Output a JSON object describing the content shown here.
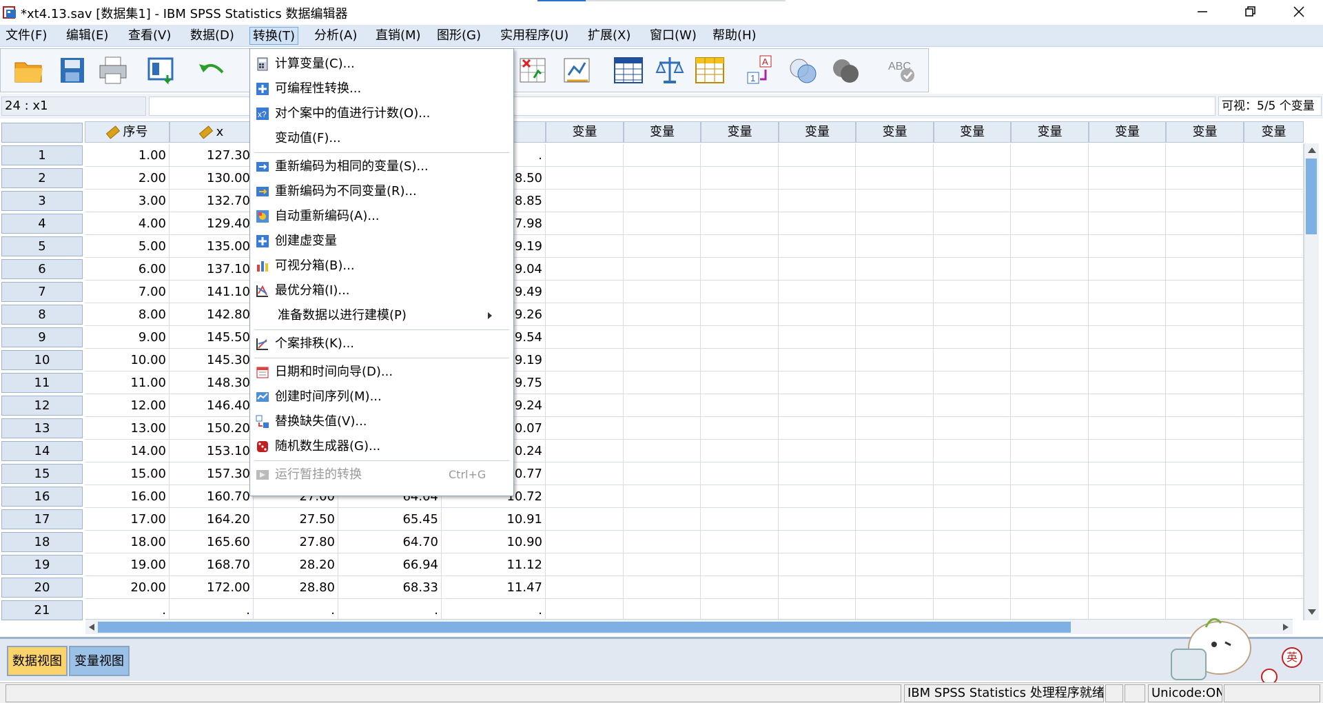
{
  "window": {
    "title": "*xt4.13.sav [数据集1] - IBM SPSS Statistics 数据编辑器",
    "accent_color": "#2b6fc8"
  },
  "menubar": [
    {
      "label": "文件(F)"
    },
    {
      "label": "编辑(E)"
    },
    {
      "label": "查看(V)"
    },
    {
      "label": "数据(D)"
    },
    {
      "label": "转换(T)"
    },
    {
      "label": "分析(A)"
    },
    {
      "label": "直销(M)"
    },
    {
      "label": "图形(G)"
    },
    {
      "label": "实用程序(U)"
    },
    {
      "label": "扩展(X)"
    },
    {
      "label": "窗口(W)"
    },
    {
      "label": "帮助(H)"
    }
  ],
  "toolbar": {
    "icons": [
      "open-folder-icon",
      "save-icon",
      "print-icon",
      "dialog-recall-icon",
      "undo-icon",
      "goto-case-icon",
      "variables-icon",
      "find-icon",
      "insert-cases-icon",
      "insert-variable-icon",
      "split-file-icon",
      "weight-cases-icon",
      "select-cases-icon",
      "value-labels-icon",
      "use-sets-icon",
      "show-all-variables-icon",
      "spell-check-icon"
    ]
  },
  "cellref": {
    "name": "24 : x1",
    "value": "",
    "visible_count": "可视：5/5 个变量"
  },
  "grid": {
    "headers": [
      "序号",
      "x",
      "",
      "",
      "",
      "变量",
      "变量",
      "变量",
      "变量",
      "变量",
      "变量",
      "变量",
      "变量",
      "变量",
      "变量"
    ],
    "rows": [
      {
        "n": "1",
        "c": [
          "1.00",
          "127.30",
          "",
          "",
          "."
        ]
      },
      {
        "n": "2",
        "c": [
          "2.00",
          "130.00",
          "",
          "",
          "8.50"
        ]
      },
      {
        "n": "3",
        "c": [
          "3.00",
          "132.70",
          "",
          "",
          "8.85"
        ]
      },
      {
        "n": "4",
        "c": [
          "4.00",
          "129.40",
          "",
          "",
          "7.98"
        ]
      },
      {
        "n": "5",
        "c": [
          "5.00",
          "135.00",
          "",
          "",
          "9.19"
        ]
      },
      {
        "n": "6",
        "c": [
          "6.00",
          "137.10",
          "",
          "",
          "9.04"
        ]
      },
      {
        "n": "7",
        "c": [
          "7.00",
          "141.10",
          "",
          "",
          "9.49"
        ]
      },
      {
        "n": "8",
        "c": [
          "8.00",
          "142.80",
          "",
          "",
          "9.26"
        ]
      },
      {
        "n": "9",
        "c": [
          "9.00",
          "145.50",
          "",
          "",
          "9.54"
        ]
      },
      {
        "n": "10",
        "c": [
          "10.00",
          "145.30",
          "",
          "",
          "9.19"
        ]
      },
      {
        "n": "11",
        "c": [
          "11.00",
          "148.30",
          "",
          "",
          "9.75"
        ]
      },
      {
        "n": "12",
        "c": [
          "12.00",
          "146.40",
          "",
          "",
          "9.24"
        ]
      },
      {
        "n": "13",
        "c": [
          "13.00",
          "150.20",
          "",
          "",
          "10.07"
        ]
      },
      {
        "n": "14",
        "c": [
          "14.00",
          "153.10",
          "",
          "",
          "10.24"
        ]
      },
      {
        "n": "15",
        "c": [
          "15.00",
          "157.30",
          "",
          "",
          "10.77"
        ]
      },
      {
        "n": "16",
        "c": [
          "16.00",
          "160.70",
          "27.00",
          "64.04",
          "10.72"
        ]
      },
      {
        "n": "17",
        "c": [
          "17.00",
          "164.20",
          "27.50",
          "65.45",
          "10.91"
        ]
      },
      {
        "n": "18",
        "c": [
          "18.00",
          "165.60",
          "27.80",
          "64.70",
          "10.90"
        ]
      },
      {
        "n": "19",
        "c": [
          "19.00",
          "168.70",
          "28.20",
          "66.94",
          "11.12"
        ]
      },
      {
        "n": "20",
        "c": [
          "20.00",
          "172.00",
          "28.80",
          "68.33",
          "11.47"
        ]
      },
      {
        "n": "21",
        "c": [
          ".",
          ".",
          ".",
          ".",
          "."
        ]
      }
    ]
  },
  "transform_menu": {
    "items": [
      {
        "label": "计算变量(C)...",
        "icon": "calculator-icon"
      },
      {
        "label": "可编程性转换...",
        "icon": "plus-icon"
      },
      {
        "label": "对个案中的值进行计数(O)...",
        "icon": "count-values-icon"
      },
      {
        "label": "变动值(F)...",
        "icon": ""
      },
      {
        "label": "重新编码为相同的变量(S)...",
        "icon": "recode-same-icon"
      },
      {
        "label": "重新编码为不同变量(R)...",
        "icon": "recode-different-icon"
      },
      {
        "label": "自动重新编码(A)...",
        "icon": "auto-recode-icon"
      },
      {
        "label": "创建虚变量",
        "icon": "plus-icon"
      },
      {
        "label": "可视分箱(B)...",
        "icon": "visual-binning-icon"
      },
      {
        "label": "最优分箱(I)...",
        "icon": "optimal-binning-icon"
      },
      {
        "label": "准备数据以进行建模(P)",
        "icon": ""
      },
      {
        "label": "个案排秩(K)...",
        "icon": "rank-cases-icon"
      },
      {
        "label": "日期和时间向导(D)...",
        "icon": "calendar-icon"
      },
      {
        "label": "创建时间序列(M)...",
        "icon": "time-series-icon"
      },
      {
        "label": "替换缺失值(V)...",
        "icon": "replace-missing-icon"
      },
      {
        "label": "随机数生成器(G)...",
        "icon": "dice-icon"
      },
      {
        "label": "运行暂挂的转换",
        "icon": "run-pending-icon"
      }
    ],
    "shortcut": "Ctrl+G"
  },
  "tabs": {
    "data_view": "数据视图",
    "variable_view": "变量视图"
  },
  "statusbar": {
    "processor": "IBM SPSS Statistics 处理程序就绪",
    "unicode": "Unicode:ON"
  },
  "ime": {
    "lang": "英"
  }
}
